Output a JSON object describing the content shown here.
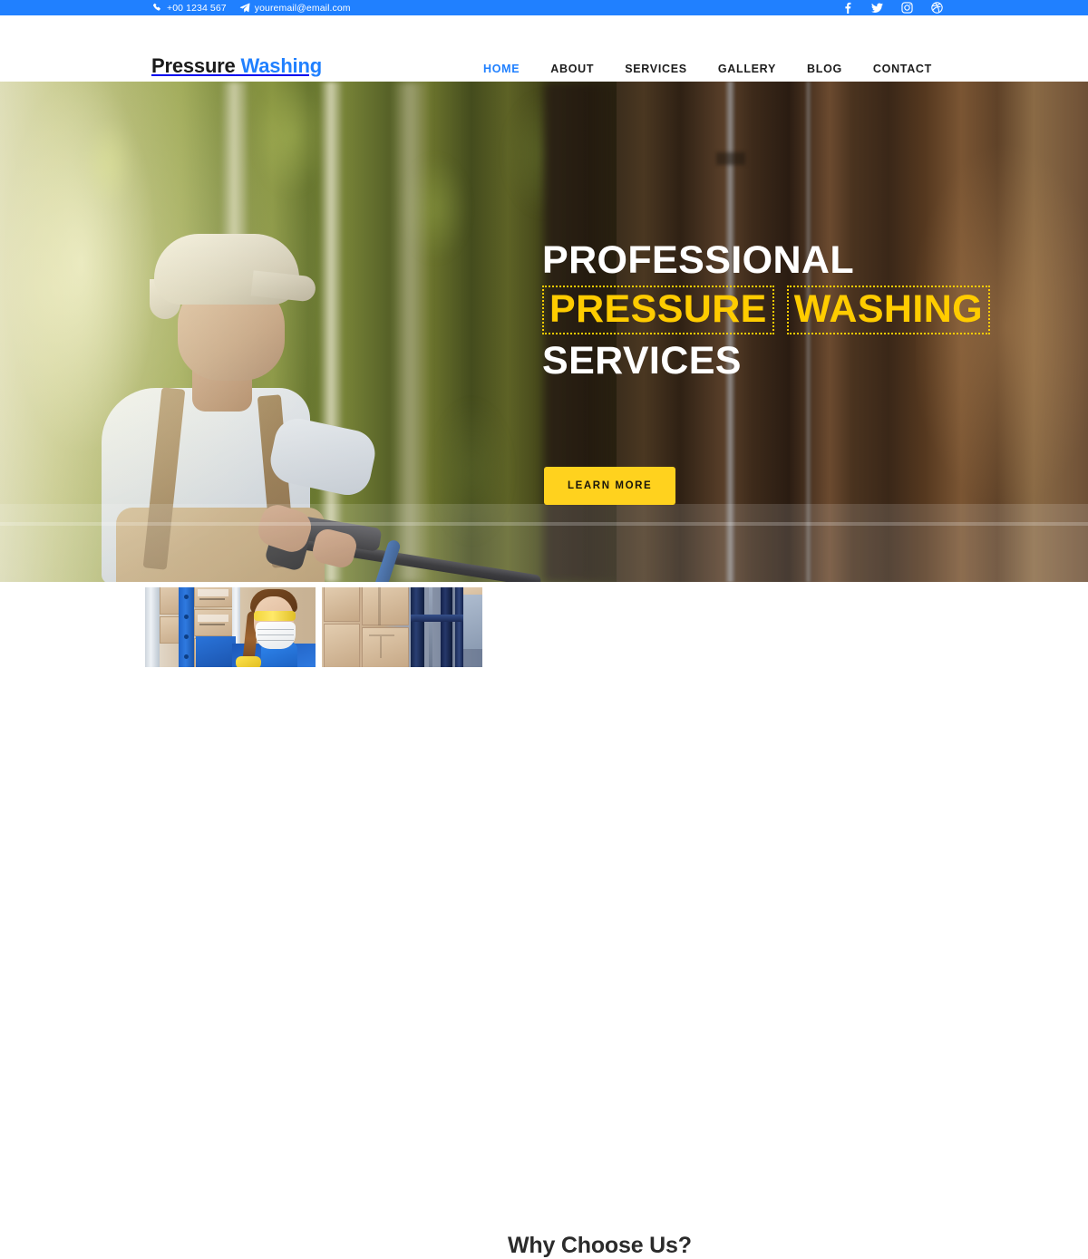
{
  "topbar": {
    "phone": "+00 1234 567",
    "phone_icon": "phone-icon",
    "email": "youremail@email.com",
    "email_icon": "paper-plane-icon",
    "socials": [
      {
        "name": "facebook-icon",
        "label": "Facebook"
      },
      {
        "name": "twitter-icon",
        "label": "Twitter"
      },
      {
        "name": "instagram-icon",
        "label": "Instagram"
      },
      {
        "name": "dribbble-icon",
        "label": "Dribbble"
      }
    ],
    "background_color": "#2080ff",
    "text_color": "#ffffff"
  },
  "header": {
    "logo_part1": "Pressure",
    "logo_part2": "Washing",
    "logo_color1": "#1b1b1b",
    "logo_color2": "#2080ff",
    "nav": [
      {
        "label": "HOME",
        "active": true
      },
      {
        "label": "ABOUT",
        "active": false
      },
      {
        "label": "SERVICES",
        "active": false
      },
      {
        "label": "GALLERY",
        "active": false
      },
      {
        "label": "BLOG",
        "active": false
      },
      {
        "label": "CONTACT",
        "active": false
      }
    ],
    "active_color": "#2080ff",
    "underline_color": "#ffcc00"
  },
  "hero": {
    "heading_line1": "PROFESSIONAL",
    "heading_highlight1": "PRESSURE",
    "heading_highlight2": "WASHING",
    "heading_line3": "SERVICES",
    "highlight_color": "#ffcc00",
    "heading_color": "#ffffff",
    "cta_label": "LEARN MORE",
    "cta_background": "#ffd21e",
    "cta_text_color": "#17150c",
    "image_alt": "Worker in cap and overalls using a pressure washer outdoors among birch trees"
  },
  "below": {
    "section_title": "Why Choose Us?",
    "title_color": "#2b2b2b",
    "images": [
      {
        "name": "warehouse-worker-photo",
        "alt": "Warehouse worker wearing face mask and yellow safety goggles beside stacked boxes"
      },
      {
        "name": "forklift-photo",
        "alt": "Blue forklift mast in front of stacked cardboard boxes in a warehouse"
      }
    ]
  }
}
